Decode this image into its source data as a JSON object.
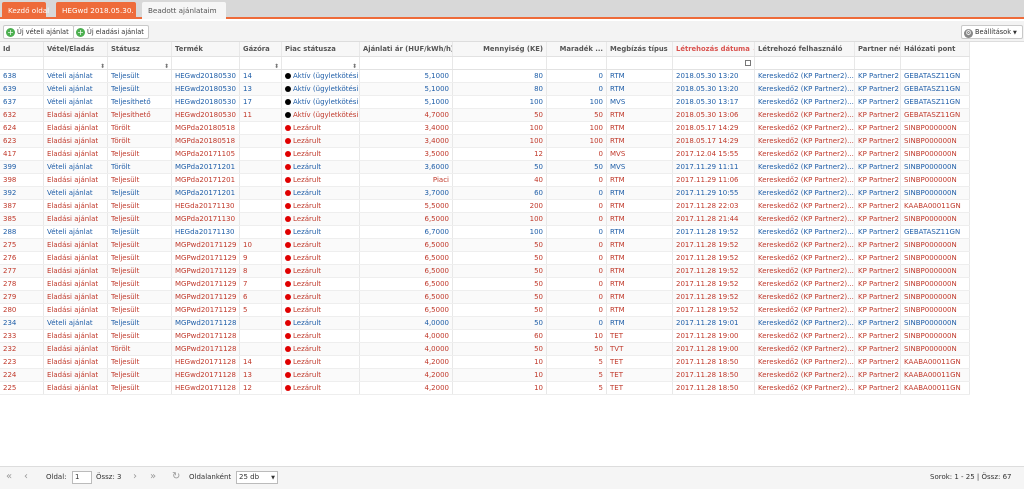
{
  "tabs": [
    {
      "label": "Kezdő oldal",
      "active": false
    },
    {
      "label": "HEGwd 2018.05.30.",
      "active": false
    },
    {
      "label": "Beadott ajánlataim",
      "active": true
    }
  ],
  "toolbar": {
    "new_buy": "Új vételi ajánlat",
    "new_sell": "Új eladási ajánlat",
    "settings": "Beállítások"
  },
  "columns": [
    {
      "key": "id",
      "label": "Id",
      "filter": ""
    },
    {
      "key": "side",
      "label": "Vétel/Eladás",
      "filter": "dropdown"
    },
    {
      "key": "status",
      "label": "Státusz",
      "filter": "dropdown"
    },
    {
      "key": "product",
      "label": "Termék",
      "filter": ""
    },
    {
      "key": "hour",
      "label": "Gázóra",
      "filter": "dropdown"
    },
    {
      "key": "market",
      "label": "Piac státusza",
      "filter": "dropdown"
    },
    {
      "key": "price",
      "label": "Ajánlati ár (HUF/kWh/h)",
      "filter": ""
    },
    {
      "key": "qty",
      "label": "Mennyiség (KE)",
      "filter": ""
    },
    {
      "key": "remain",
      "label": "Maradék ...",
      "filter": ""
    },
    {
      "key": "order",
      "label": "Megbízás típus",
      "filter": ""
    },
    {
      "key": "created",
      "label": "Létrehozás dátuma ↓",
      "filter": "calendar"
    },
    {
      "key": "user",
      "label": "Létrehozó felhasználó",
      "filter": ""
    },
    {
      "key": "partner",
      "label": "Partner név",
      "filter": ""
    },
    {
      "key": "point",
      "label": "Hálózati pont",
      "filter": ""
    }
  ],
  "colors": {
    "sell": "#c0392b",
    "buy": "#1f5ea8",
    "active_dot": "#000000",
    "closed_dot": "#e00000",
    "accent": "#ee6b3a"
  },
  "rows": [
    {
      "id": "638",
      "side": "Vételi ajánlat",
      "status": "Teljesült",
      "product": "HEGwd20180530",
      "hour": "14",
      "market": "Aktív (ügyletkötési)",
      "price": "5,1000",
      "qty": "80",
      "remain": "0",
      "order": "RTM",
      "created": "2018.05.30 13:20",
      "user": "Kereskedő2 (KP Partner2)...",
      "partner": "KP Partner2",
      "point": "GEBATASZ11GN",
      "kind": "buy",
      "dot": "active"
    },
    {
      "id": "639",
      "side": "Vételi ajánlat",
      "status": "Teljesült",
      "product": "HEGwd20180530",
      "hour": "13",
      "market": "Aktív (ügyletkötési)",
      "price": "5,1000",
      "qty": "80",
      "remain": "0",
      "order": "RTM",
      "created": "2018.05.30 13:20",
      "user": "Kereskedő2 (KP Partner2)...",
      "partner": "KP Partner2",
      "point": "GEBATASZ11GN",
      "kind": "buy",
      "dot": "active"
    },
    {
      "id": "637",
      "side": "Vételi ajánlat",
      "status": "Teljesíthető",
      "product": "HEGwd20180530",
      "hour": "17",
      "market": "Aktív (ügyletkötési)",
      "price": "5,1000",
      "qty": "100",
      "remain": "100",
      "order": "MVS",
      "created": "2018.05.30 13:17",
      "user": "Kereskedő2 (KP Partner2)...",
      "partner": "KP Partner2",
      "point": "GEBATASZ11GN",
      "kind": "buy",
      "dot": "active"
    },
    {
      "id": "632",
      "side": "Eladási ajánlat",
      "status": "Teljesíthető",
      "product": "HEGwd20180530",
      "hour": "11",
      "market": "Aktív (ügyletkötési)",
      "price": "4,7000",
      "qty": "50",
      "remain": "50",
      "order": "RTM",
      "created": "2018.05.30 13:06",
      "user": "Kereskedő2 (KP Partner2)...",
      "partner": "KP Partner2",
      "point": "GEBATASZ11GN",
      "kind": "sell",
      "dot": "active"
    },
    {
      "id": "624",
      "side": "Eladási ajánlat",
      "status": "Törölt",
      "product": "MGPda20180518",
      "hour": "",
      "market": "Lezárult",
      "price": "3,4000",
      "qty": "100",
      "remain": "100",
      "order": "RTM",
      "created": "2018.05.17 14:29",
      "user": "Kereskedő2 (KP Partner2)...",
      "partner": "KP Partner2",
      "point": "SINBP000000N",
      "kind": "sell",
      "dot": "closed"
    },
    {
      "id": "623",
      "side": "Eladási ajánlat",
      "status": "Törölt",
      "product": "MGPda20180518",
      "hour": "",
      "market": "Lezárult",
      "price": "3,4000",
      "qty": "100",
      "remain": "100",
      "order": "RTM",
      "created": "2018.05.17 14:29",
      "user": "Kereskedő2 (KP Partner2)...",
      "partner": "KP Partner2",
      "point": "SINBP000000N",
      "kind": "sell",
      "dot": "closed"
    },
    {
      "id": "417",
      "side": "Eladási ajánlat",
      "status": "Teljesült",
      "product": "MGPda20171105",
      "hour": "",
      "market": "Lezárult",
      "price": "3,5000",
      "qty": "12",
      "remain": "0",
      "order": "MVS",
      "created": "2017.12.04 15:55",
      "user": "Kereskedő2 (KP Partner2)...",
      "partner": "KP Partner2",
      "point": "SINBP000000N",
      "kind": "sell",
      "dot": "closed"
    },
    {
      "id": "399",
      "side": "Vételi ajánlat",
      "status": "Törölt",
      "product": "MGPda20171201",
      "hour": "",
      "market": "Lezárult",
      "price": "3,6000",
      "qty": "50",
      "remain": "50",
      "order": "MVS",
      "created": "2017.11.29 11:11",
      "user": "Kereskedő2 (KP Partner2)...",
      "partner": "KP Partner2",
      "point": "SINBP000000N",
      "kind": "buy",
      "dot": "closed"
    },
    {
      "id": "398",
      "side": "Eladási ajánlat",
      "status": "Teljesült",
      "product": "MGPda20171201",
      "hour": "",
      "market": "Lezárult",
      "price": "Piaci",
      "qty": "40",
      "remain": "0",
      "order": "RTM",
      "created": "2017.11.29 11:06",
      "user": "Kereskedő2 (KP Partner2)...",
      "partner": "KP Partner2",
      "point": "SINBP000000N",
      "kind": "sell",
      "dot": "closed"
    },
    {
      "id": "392",
      "side": "Vételi ajánlat",
      "status": "Teljesült",
      "product": "MGPda20171201",
      "hour": "",
      "market": "Lezárult",
      "price": "3,7000",
      "qty": "60",
      "remain": "0",
      "order": "RTM",
      "created": "2017.11.29 10:55",
      "user": "Kereskedő2 (KP Partner2)...",
      "partner": "KP Partner2",
      "point": "SINBP000000N",
      "kind": "buy",
      "dot": "closed"
    },
    {
      "id": "387",
      "side": "Eladási ajánlat",
      "status": "Teljesült",
      "product": "HEGda20171130",
      "hour": "",
      "market": "Lezárult",
      "price": "5,5000",
      "qty": "200",
      "remain": "0",
      "order": "RTM",
      "created": "2017.11.28 22:03",
      "user": "Kereskedő2 (KP Partner2)...",
      "partner": "KP Partner2",
      "point": "KAABA00011GN",
      "kind": "sell",
      "dot": "closed"
    },
    {
      "id": "385",
      "side": "Eladási ajánlat",
      "status": "Teljesült",
      "product": "MGPda20171130",
      "hour": "",
      "market": "Lezárult",
      "price": "6,5000",
      "qty": "100",
      "remain": "0",
      "order": "RTM",
      "created": "2017.11.28 21:44",
      "user": "Kereskedő2 (KP Partner2)...",
      "partner": "KP Partner2",
      "point": "SINBP000000N",
      "kind": "sell",
      "dot": "closed"
    },
    {
      "id": "288",
      "side": "Vételi ajánlat",
      "status": "Teljesült",
      "product": "HEGda20171130",
      "hour": "",
      "market": "Lezárult",
      "price": "6,7000",
      "qty": "100",
      "remain": "0",
      "order": "RTM",
      "created": "2017.11.28 19:52",
      "user": "Kereskedő2 (KP Partner2)...",
      "partner": "KP Partner2",
      "point": "GEBATASZ11GN",
      "kind": "buy",
      "dot": "closed"
    },
    {
      "id": "275",
      "side": "Eladási ajánlat",
      "status": "Teljesült",
      "product": "MGPwd20171129",
      "hour": "10",
      "market": "Lezárult",
      "price": "6,5000",
      "qty": "50",
      "remain": "0",
      "order": "RTM",
      "created": "2017.11.28 19:52",
      "user": "Kereskedő2 (KP Partner2)...",
      "partner": "KP Partner2",
      "point": "SINBP000000N",
      "kind": "sell",
      "dot": "closed"
    },
    {
      "id": "276",
      "side": "Eladási ajánlat",
      "status": "Teljesült",
      "product": "MGPwd20171129",
      "hour": "9",
      "market": "Lezárult",
      "price": "6,5000",
      "qty": "50",
      "remain": "0",
      "order": "RTM",
      "created": "2017.11.28 19:52",
      "user": "Kereskedő2 (KP Partner2)...",
      "partner": "KP Partner2",
      "point": "SINBP000000N",
      "kind": "sell",
      "dot": "closed"
    },
    {
      "id": "277",
      "side": "Eladási ajánlat",
      "status": "Teljesült",
      "product": "MGPwd20171129",
      "hour": "8",
      "market": "Lezárult",
      "price": "6,5000",
      "qty": "50",
      "remain": "0",
      "order": "RTM",
      "created": "2017.11.28 19:52",
      "user": "Kereskedő2 (KP Partner2)...",
      "partner": "KP Partner2",
      "point": "SINBP000000N",
      "kind": "sell",
      "dot": "closed"
    },
    {
      "id": "278",
      "side": "Eladási ajánlat",
      "status": "Teljesült",
      "product": "MGPwd20171129",
      "hour": "7",
      "market": "Lezárult",
      "price": "6,5000",
      "qty": "50",
      "remain": "0",
      "order": "RTM",
      "created": "2017.11.28 19:52",
      "user": "Kereskedő2 (KP Partner2)...",
      "partner": "KP Partner2",
      "point": "SINBP000000N",
      "kind": "sell",
      "dot": "closed"
    },
    {
      "id": "279",
      "side": "Eladási ajánlat",
      "status": "Teljesült",
      "product": "MGPwd20171129",
      "hour": "6",
      "market": "Lezárult",
      "price": "6,5000",
      "qty": "50",
      "remain": "0",
      "order": "RTM",
      "created": "2017.11.28 19:52",
      "user": "Kereskedő2 (KP Partner2)...",
      "partner": "KP Partner2",
      "point": "SINBP000000N",
      "kind": "sell",
      "dot": "closed"
    },
    {
      "id": "280",
      "side": "Eladási ajánlat",
      "status": "Teljesült",
      "product": "MGPwd20171129",
      "hour": "5",
      "market": "Lezárult",
      "price": "6,5000",
      "qty": "50",
      "remain": "0",
      "order": "RTM",
      "created": "2017.11.28 19:52",
      "user": "Kereskedő2 (KP Partner2)...",
      "partner": "KP Partner2",
      "point": "SINBP000000N",
      "kind": "sell",
      "dot": "closed"
    },
    {
      "id": "234",
      "side": "Vételi ajánlat",
      "status": "Teljesült",
      "product": "MGPwd20171128",
      "hour": "",
      "market": "Lezárult",
      "price": "4,0000",
      "qty": "50",
      "remain": "0",
      "order": "RTM",
      "created": "2017.11.28 19:01",
      "user": "Kereskedő2 (KP Partner2)...",
      "partner": "KP Partner2",
      "point": "SINBP000000N",
      "kind": "buy",
      "dot": "closed"
    },
    {
      "id": "233",
      "side": "Eladási ajánlat",
      "status": "Teljesült",
      "product": "MGPwd20171128",
      "hour": "",
      "market": "Lezárult",
      "price": "4,0000",
      "qty": "60",
      "remain": "10",
      "order": "TET",
      "created": "2017.11.28 19:00",
      "user": "Kereskedő2 (KP Partner2)...",
      "partner": "KP Partner2",
      "point": "SINBP000000N",
      "kind": "sell",
      "dot": "closed"
    },
    {
      "id": "232",
      "side": "Eladási ajánlat",
      "status": "Törölt",
      "product": "MGPwd20171128",
      "hour": "",
      "market": "Lezárult",
      "price": "4,0000",
      "qty": "50",
      "remain": "50",
      "order": "TVT",
      "created": "2017.11.28 19:00",
      "user": "Kereskedő2 (KP Partner2)...",
      "partner": "KP Partner2",
      "point": "SINBP000000N",
      "kind": "sell",
      "dot": "closed"
    },
    {
      "id": "223",
      "side": "Eladási ajánlat",
      "status": "Teljesült",
      "product": "HEGwd20171128",
      "hour": "14",
      "market": "Lezárult",
      "price": "4,2000",
      "qty": "10",
      "remain": "5",
      "order": "TET",
      "created": "2017.11.28 18:50",
      "user": "Kereskedő2 (KP Partner2)...",
      "partner": "KP Partner2",
      "point": "KAABA00011GN",
      "kind": "sell",
      "dot": "closed"
    },
    {
      "id": "224",
      "side": "Eladási ajánlat",
      "status": "Teljesült",
      "product": "HEGwd20171128",
      "hour": "13",
      "market": "Lezárult",
      "price": "4,2000",
      "qty": "10",
      "remain": "5",
      "order": "TET",
      "created": "2017.11.28 18:50",
      "user": "Kereskedő2 (KP Partner2)...",
      "partner": "KP Partner2",
      "point": "KAABA00011GN",
      "kind": "sell",
      "dot": "closed"
    },
    {
      "id": "225",
      "side": "Eladási ajánlat",
      "status": "Teljesült",
      "product": "HEGwd20171128",
      "hour": "12",
      "market": "Lezárult",
      "price": "4,2000",
      "qty": "10",
      "remain": "5",
      "order": "TET",
      "created": "2017.11.28 18:50",
      "user": "Kereskedő2 (KP Partner2)...",
      "partner": "KP Partner2",
      "point": "KAABA00011GN",
      "kind": "sell",
      "dot": "closed"
    }
  ],
  "pager": {
    "page_label": "Oldal:",
    "page_value": "1",
    "total_label": "Össz: 3",
    "per_page_label": "Oldalanként",
    "per_page_value": "25 db",
    "rows_info": "Sorok: 1 - 25 | Össz: 67"
  }
}
